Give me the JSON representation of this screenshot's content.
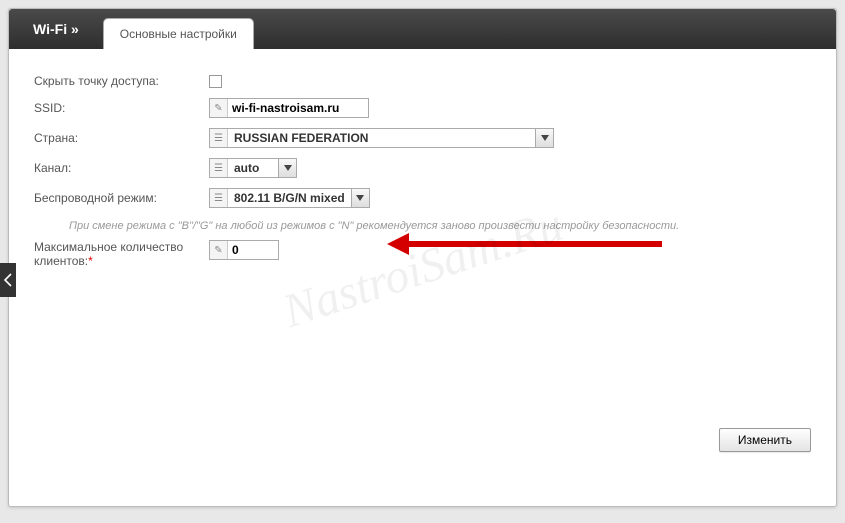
{
  "header": {
    "title": "Wi-Fi »",
    "tab": "Основные настройки"
  },
  "form": {
    "hide_ap_label": "Скрыть точку доступа:",
    "hide_ap_checked": false,
    "ssid_label": "SSID:",
    "ssid_value": "wi-fi-nastroisam.ru",
    "country_label": "Страна:",
    "country_value": "RUSSIAN FEDERATION",
    "channel_label": "Канал:",
    "channel_value": "auto",
    "mode_label": "Беспроводной режим:",
    "mode_value": "802.11 B/G/N mixed",
    "mode_note": "При смене режима с \"B\"/\"G\" на любой из режимов с \"N\" рекомендуется заново произвести настройку безопасности.",
    "max_clients_label": "Максимальное количество клиентов:",
    "max_clients_value": "0"
  },
  "buttons": {
    "save": "Изменить"
  },
  "watermark": "NastroiSam.Ru"
}
